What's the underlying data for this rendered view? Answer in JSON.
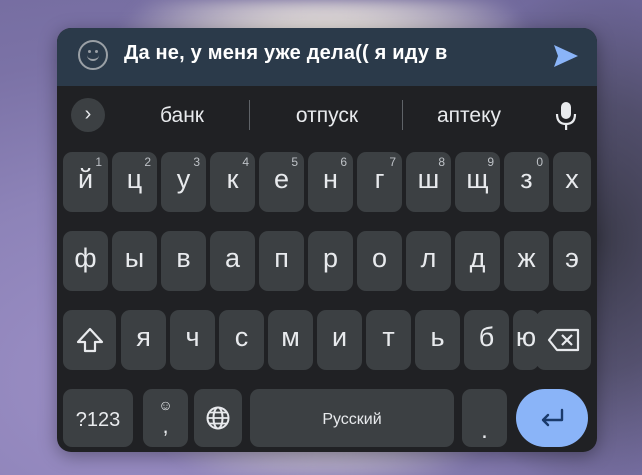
{
  "input": {
    "text": "Да не, у меня уже дела(( я иду в",
    "emoji_icon": "emoji-smile-icon",
    "send_icon": "send-arrow-icon",
    "accent_color": "#8ab4f8"
  },
  "suggestions": {
    "expand_label": "›",
    "items": [
      "банк",
      "отпуск",
      "аптеку"
    ],
    "mic_icon": "microphone-icon"
  },
  "keyboard": {
    "row1": [
      {
        "ch": "й",
        "hint": "1"
      },
      {
        "ch": "ц",
        "hint": "2"
      },
      {
        "ch": "у",
        "hint": "3"
      },
      {
        "ch": "к",
        "hint": "4"
      },
      {
        "ch": "е",
        "hint": "5"
      },
      {
        "ch": "н",
        "hint": "6"
      },
      {
        "ch": "г",
        "hint": "7"
      },
      {
        "ch": "ш",
        "hint": "8"
      },
      {
        "ch": "щ",
        "hint": "9"
      },
      {
        "ch": "з",
        "hint": "0"
      },
      {
        "ch": "х",
        "hint": ""
      }
    ],
    "row2": [
      "ф",
      "ы",
      "в",
      "а",
      "п",
      "р",
      "о",
      "л",
      "д",
      "ж",
      "э"
    ],
    "row3": [
      "я",
      "ч",
      "с",
      "м",
      "и",
      "т",
      "ь",
      "б",
      "ю"
    ],
    "shift_icon": "shift-arrow-icon",
    "backspace_icon": "backspace-icon",
    "symbols_label": "?123",
    "emoji_key_top": "☺",
    "emoji_key_bottom": ",",
    "globe_icon": "globe-icon",
    "space_label": "Русский",
    "period_label": ".",
    "enter_icon": "enter-return-icon"
  }
}
